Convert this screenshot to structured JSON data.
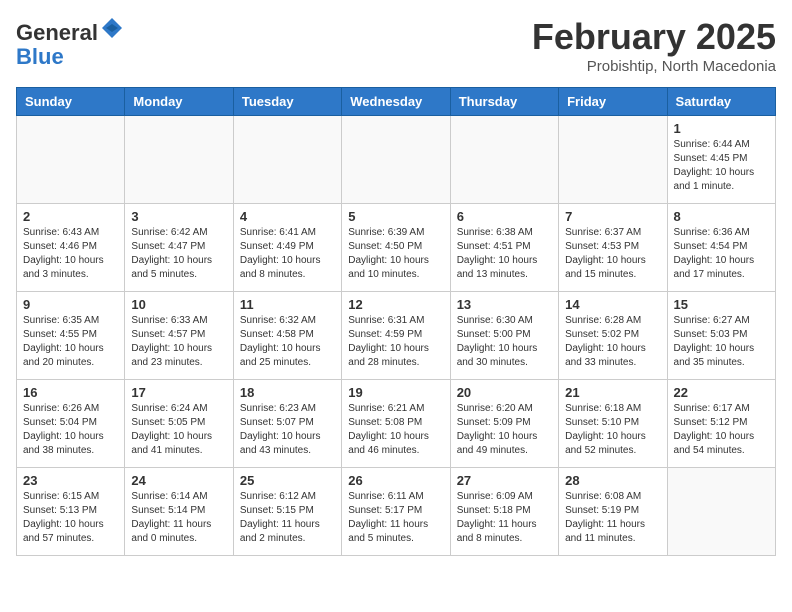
{
  "header": {
    "logo_general": "General",
    "logo_blue": "Blue",
    "month_title": "February 2025",
    "location": "Probishtip, North Macedonia"
  },
  "days_of_week": [
    "Sunday",
    "Monday",
    "Tuesday",
    "Wednesday",
    "Thursday",
    "Friday",
    "Saturday"
  ],
  "weeks": [
    [
      {
        "day": "",
        "info": ""
      },
      {
        "day": "",
        "info": ""
      },
      {
        "day": "",
        "info": ""
      },
      {
        "day": "",
        "info": ""
      },
      {
        "day": "",
        "info": ""
      },
      {
        "day": "",
        "info": ""
      },
      {
        "day": "1",
        "info": "Sunrise: 6:44 AM\nSunset: 4:45 PM\nDaylight: 10 hours\nand 1 minute."
      }
    ],
    [
      {
        "day": "2",
        "info": "Sunrise: 6:43 AM\nSunset: 4:46 PM\nDaylight: 10 hours\nand 3 minutes."
      },
      {
        "day": "3",
        "info": "Sunrise: 6:42 AM\nSunset: 4:47 PM\nDaylight: 10 hours\nand 5 minutes."
      },
      {
        "day": "4",
        "info": "Sunrise: 6:41 AM\nSunset: 4:49 PM\nDaylight: 10 hours\nand 8 minutes."
      },
      {
        "day": "5",
        "info": "Sunrise: 6:39 AM\nSunset: 4:50 PM\nDaylight: 10 hours\nand 10 minutes."
      },
      {
        "day": "6",
        "info": "Sunrise: 6:38 AM\nSunset: 4:51 PM\nDaylight: 10 hours\nand 13 minutes."
      },
      {
        "day": "7",
        "info": "Sunrise: 6:37 AM\nSunset: 4:53 PM\nDaylight: 10 hours\nand 15 minutes."
      },
      {
        "day": "8",
        "info": "Sunrise: 6:36 AM\nSunset: 4:54 PM\nDaylight: 10 hours\nand 17 minutes."
      }
    ],
    [
      {
        "day": "9",
        "info": "Sunrise: 6:35 AM\nSunset: 4:55 PM\nDaylight: 10 hours\nand 20 minutes."
      },
      {
        "day": "10",
        "info": "Sunrise: 6:33 AM\nSunset: 4:57 PM\nDaylight: 10 hours\nand 23 minutes."
      },
      {
        "day": "11",
        "info": "Sunrise: 6:32 AM\nSunset: 4:58 PM\nDaylight: 10 hours\nand 25 minutes."
      },
      {
        "day": "12",
        "info": "Sunrise: 6:31 AM\nSunset: 4:59 PM\nDaylight: 10 hours\nand 28 minutes."
      },
      {
        "day": "13",
        "info": "Sunrise: 6:30 AM\nSunset: 5:00 PM\nDaylight: 10 hours\nand 30 minutes."
      },
      {
        "day": "14",
        "info": "Sunrise: 6:28 AM\nSunset: 5:02 PM\nDaylight: 10 hours\nand 33 minutes."
      },
      {
        "day": "15",
        "info": "Sunrise: 6:27 AM\nSunset: 5:03 PM\nDaylight: 10 hours\nand 35 minutes."
      }
    ],
    [
      {
        "day": "16",
        "info": "Sunrise: 6:26 AM\nSunset: 5:04 PM\nDaylight: 10 hours\nand 38 minutes."
      },
      {
        "day": "17",
        "info": "Sunrise: 6:24 AM\nSunset: 5:05 PM\nDaylight: 10 hours\nand 41 minutes."
      },
      {
        "day": "18",
        "info": "Sunrise: 6:23 AM\nSunset: 5:07 PM\nDaylight: 10 hours\nand 43 minutes."
      },
      {
        "day": "19",
        "info": "Sunrise: 6:21 AM\nSunset: 5:08 PM\nDaylight: 10 hours\nand 46 minutes."
      },
      {
        "day": "20",
        "info": "Sunrise: 6:20 AM\nSunset: 5:09 PM\nDaylight: 10 hours\nand 49 minutes."
      },
      {
        "day": "21",
        "info": "Sunrise: 6:18 AM\nSunset: 5:10 PM\nDaylight: 10 hours\nand 52 minutes."
      },
      {
        "day": "22",
        "info": "Sunrise: 6:17 AM\nSunset: 5:12 PM\nDaylight: 10 hours\nand 54 minutes."
      }
    ],
    [
      {
        "day": "23",
        "info": "Sunrise: 6:15 AM\nSunset: 5:13 PM\nDaylight: 10 hours\nand 57 minutes."
      },
      {
        "day": "24",
        "info": "Sunrise: 6:14 AM\nSunset: 5:14 PM\nDaylight: 11 hours\nand 0 minutes."
      },
      {
        "day": "25",
        "info": "Sunrise: 6:12 AM\nSunset: 5:15 PM\nDaylight: 11 hours\nand 2 minutes."
      },
      {
        "day": "26",
        "info": "Sunrise: 6:11 AM\nSunset: 5:17 PM\nDaylight: 11 hours\nand 5 minutes."
      },
      {
        "day": "27",
        "info": "Sunrise: 6:09 AM\nSunset: 5:18 PM\nDaylight: 11 hours\nand 8 minutes."
      },
      {
        "day": "28",
        "info": "Sunrise: 6:08 AM\nSunset: 5:19 PM\nDaylight: 11 hours\nand 11 minutes."
      },
      {
        "day": "",
        "info": ""
      }
    ]
  ]
}
